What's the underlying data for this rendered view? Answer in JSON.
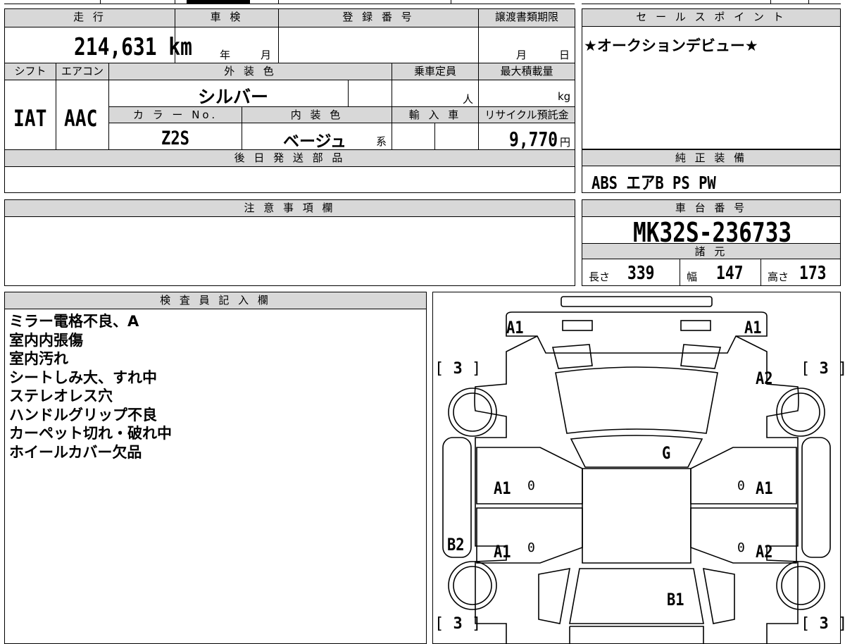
{
  "vehicle": {
    "mileage_label": "走 行",
    "mileage_value": "214,631 km",
    "inspection_label": "車 検",
    "inspection_year_unit": "年",
    "inspection_month_unit": "月",
    "registration_label": "登 録 番 号",
    "transfer_deadline_label": "譲渡書類期限",
    "transfer_month_unit": "月",
    "transfer_day_unit": "日",
    "shift_label": "シフト",
    "shift_value": "IAT",
    "ac_label": "エアコン",
    "ac_value": "AAC",
    "exterior_color_label": "外 装 色",
    "exterior_color_value": "シルバー",
    "capacity_label": "乗車定員",
    "capacity_unit": "人",
    "max_load_label": "最大積載量",
    "max_load_unit": "kg",
    "color_no_label": "カ ラ ー No.",
    "color_no_value": "Z2S",
    "interior_color_label": "内 装 色",
    "interior_color_value": "ベージュ",
    "interior_color_suffix": "系",
    "import_label": "輸 入 車",
    "recycle_label": "リサイクル預託金",
    "recycle_value": "9,770",
    "recycle_unit": "円",
    "later_parts_label": "後 日 発 送 部 品"
  },
  "sales_point": {
    "label": "セ ー ル ス ポ イ ン ト",
    "text": "★オークションデビュー★"
  },
  "equipment": {
    "label": "純 正 装 備",
    "text": "ABS エアB PS PW"
  },
  "notes": {
    "label": "注 意 事 項 欄"
  },
  "chassis": {
    "label": "車 台 番 号",
    "value": "MK32S-236733"
  },
  "specs": {
    "label": "諸 元",
    "length_label": "長さ",
    "length_value": "339",
    "width_label": "幅",
    "width_value": "147",
    "height_label": "高さ",
    "height_value": "173"
  },
  "inspector": {
    "label": "検 査 員 記 入 欄",
    "lines": [
      "ミラー電格不良、A",
      "室内内張傷",
      "室内汚れ",
      "シートしみ大、すれ中",
      "ステレオレス穴",
      "ハンドルグリップ不良",
      "カーペット切れ・破れ中",
      "ホイールカバー欠品"
    ]
  },
  "diagram": {
    "marks": {
      "front_left": "A1",
      "front_right": "A1",
      "front_right_fender": "A2",
      "windshield": "G",
      "left_front_door": "A1",
      "right_front_door": "A1",
      "left_rear_door": "A1",
      "right_rear_door": "A2",
      "left_side": "B2",
      "rear": "B1"
    },
    "tread": {
      "front_left": "3",
      "front_right": "3",
      "rear_left": "3",
      "rear_right": "3"
    },
    "door_zero": "0"
  }
}
